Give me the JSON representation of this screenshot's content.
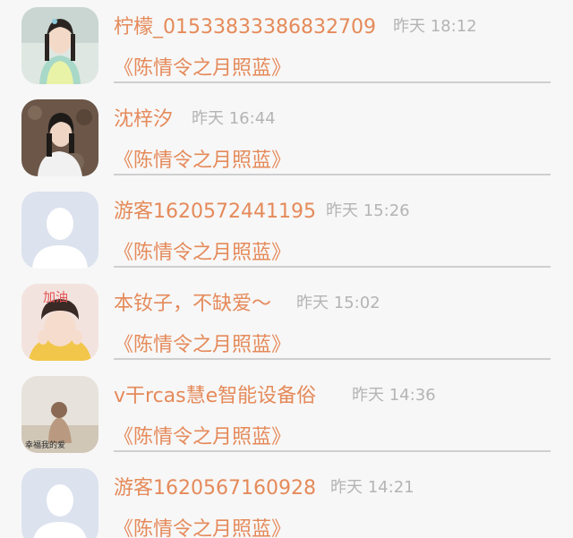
{
  "comments": [
    {
      "name": "柠檬_01533833386832709",
      "time": "昨天 18:12",
      "content": "《陈情令之月照蓝》",
      "avatar": "photo-portrait-costume"
    },
    {
      "name": "沈梓汐",
      "time": "昨天 16:44",
      "content": "《陈情令之月照蓝》",
      "avatar": "photo-portrait-girl"
    },
    {
      "name": "游客1620572441195",
      "time": "昨天 15:26",
      "content": "《陈情令之月照蓝》",
      "avatar": "default-user-icon"
    },
    {
      "name": "本钕子，不缺爱～",
      "time": "昨天 15:02",
      "content": "《陈情令之月照蓝》",
      "avatar": "photo-portrait-cheer",
      "avatar_text": "加油"
    },
    {
      "name": "v干rcas慧e智能设备俗",
      "time": "昨天 14:36",
      "content": "《陈情令之月照蓝》",
      "avatar": "photo-beach-sitting",
      "avatar_text": "幸福我的爱"
    },
    {
      "name": "游客1620567160928",
      "time": "昨天 14:21",
      "content": "《陈情令之月照蓝》",
      "avatar": "default-user-icon"
    }
  ],
  "colors": {
    "name": "#e58a5a",
    "time": "#b4b4b4",
    "content": "#e58a5a",
    "divider": "#cfcfcf",
    "background": "#f7f7f7"
  }
}
